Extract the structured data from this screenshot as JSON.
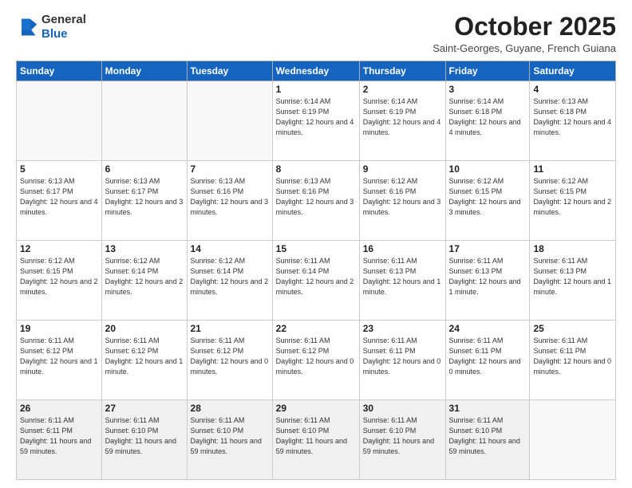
{
  "logo": {
    "general": "General",
    "blue": "Blue"
  },
  "header": {
    "month": "October 2025",
    "location": "Saint-Georges, Guyane, French Guiana"
  },
  "weekdays": [
    "Sunday",
    "Monday",
    "Tuesday",
    "Wednesday",
    "Thursday",
    "Friday",
    "Saturday"
  ],
  "weeks": [
    [
      {
        "day": "",
        "info": ""
      },
      {
        "day": "",
        "info": ""
      },
      {
        "day": "",
        "info": ""
      },
      {
        "day": "1",
        "info": "Sunrise: 6:14 AM\nSunset: 6:19 PM\nDaylight: 12 hours and 4 minutes."
      },
      {
        "day": "2",
        "info": "Sunrise: 6:14 AM\nSunset: 6:19 PM\nDaylight: 12 hours and 4 minutes."
      },
      {
        "day": "3",
        "info": "Sunrise: 6:14 AM\nSunset: 6:18 PM\nDaylight: 12 hours and 4 minutes."
      },
      {
        "day": "4",
        "info": "Sunrise: 6:13 AM\nSunset: 6:18 PM\nDaylight: 12 hours and 4 minutes."
      }
    ],
    [
      {
        "day": "5",
        "info": "Sunrise: 6:13 AM\nSunset: 6:17 PM\nDaylight: 12 hours and 4 minutes."
      },
      {
        "day": "6",
        "info": "Sunrise: 6:13 AM\nSunset: 6:17 PM\nDaylight: 12 hours and 3 minutes."
      },
      {
        "day": "7",
        "info": "Sunrise: 6:13 AM\nSunset: 6:16 PM\nDaylight: 12 hours and 3 minutes."
      },
      {
        "day": "8",
        "info": "Sunrise: 6:13 AM\nSunset: 6:16 PM\nDaylight: 12 hours and 3 minutes."
      },
      {
        "day": "9",
        "info": "Sunrise: 6:12 AM\nSunset: 6:16 PM\nDaylight: 12 hours and 3 minutes."
      },
      {
        "day": "10",
        "info": "Sunrise: 6:12 AM\nSunset: 6:15 PM\nDaylight: 12 hours and 3 minutes."
      },
      {
        "day": "11",
        "info": "Sunrise: 6:12 AM\nSunset: 6:15 PM\nDaylight: 12 hours and 2 minutes."
      }
    ],
    [
      {
        "day": "12",
        "info": "Sunrise: 6:12 AM\nSunset: 6:15 PM\nDaylight: 12 hours and 2 minutes."
      },
      {
        "day": "13",
        "info": "Sunrise: 6:12 AM\nSunset: 6:14 PM\nDaylight: 12 hours and 2 minutes."
      },
      {
        "day": "14",
        "info": "Sunrise: 6:12 AM\nSunset: 6:14 PM\nDaylight: 12 hours and 2 minutes."
      },
      {
        "day": "15",
        "info": "Sunrise: 6:11 AM\nSunset: 6:14 PM\nDaylight: 12 hours and 2 minutes."
      },
      {
        "day": "16",
        "info": "Sunrise: 6:11 AM\nSunset: 6:13 PM\nDaylight: 12 hours and 1 minute."
      },
      {
        "day": "17",
        "info": "Sunrise: 6:11 AM\nSunset: 6:13 PM\nDaylight: 12 hours and 1 minute."
      },
      {
        "day": "18",
        "info": "Sunrise: 6:11 AM\nSunset: 6:13 PM\nDaylight: 12 hours and 1 minute."
      }
    ],
    [
      {
        "day": "19",
        "info": "Sunrise: 6:11 AM\nSunset: 6:12 PM\nDaylight: 12 hours and 1 minute."
      },
      {
        "day": "20",
        "info": "Sunrise: 6:11 AM\nSunset: 6:12 PM\nDaylight: 12 hours and 1 minute."
      },
      {
        "day": "21",
        "info": "Sunrise: 6:11 AM\nSunset: 6:12 PM\nDaylight: 12 hours and 0 minutes."
      },
      {
        "day": "22",
        "info": "Sunrise: 6:11 AM\nSunset: 6:12 PM\nDaylight: 12 hours and 0 minutes."
      },
      {
        "day": "23",
        "info": "Sunrise: 6:11 AM\nSunset: 6:11 PM\nDaylight: 12 hours and 0 minutes."
      },
      {
        "day": "24",
        "info": "Sunrise: 6:11 AM\nSunset: 6:11 PM\nDaylight: 12 hours and 0 minutes."
      },
      {
        "day": "25",
        "info": "Sunrise: 6:11 AM\nSunset: 6:11 PM\nDaylight: 12 hours and 0 minutes."
      }
    ],
    [
      {
        "day": "26",
        "info": "Sunrise: 6:11 AM\nSunset: 6:11 PM\nDaylight: 11 hours and 59 minutes."
      },
      {
        "day": "27",
        "info": "Sunrise: 6:11 AM\nSunset: 6:10 PM\nDaylight: 11 hours and 59 minutes."
      },
      {
        "day": "28",
        "info": "Sunrise: 6:11 AM\nSunset: 6:10 PM\nDaylight: 11 hours and 59 minutes."
      },
      {
        "day": "29",
        "info": "Sunrise: 6:11 AM\nSunset: 6:10 PM\nDaylight: 11 hours and 59 minutes."
      },
      {
        "day": "30",
        "info": "Sunrise: 6:11 AM\nSunset: 6:10 PM\nDaylight: 11 hours and 59 minutes."
      },
      {
        "day": "31",
        "info": "Sunrise: 6:11 AM\nSunset: 6:10 PM\nDaylight: 11 hours and 59 minutes."
      },
      {
        "day": "",
        "info": ""
      }
    ]
  ]
}
